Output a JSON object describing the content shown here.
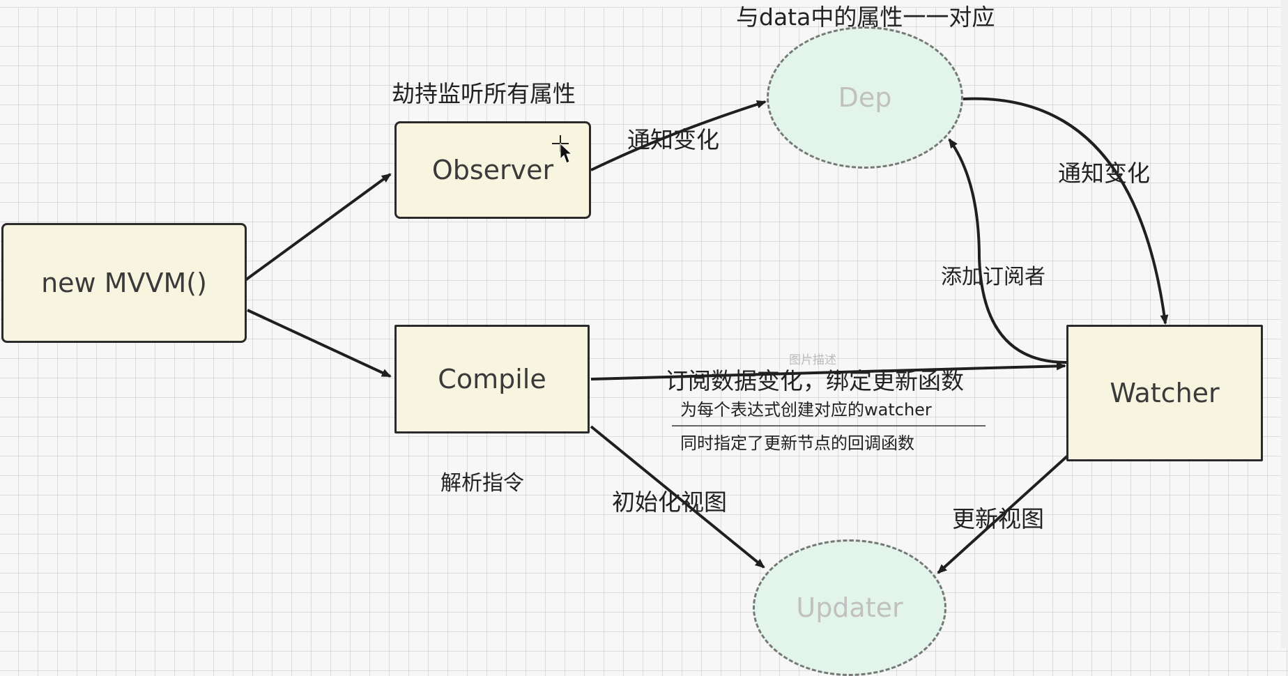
{
  "nodes": {
    "mvvm": "new MVVM()",
    "observer": "Observer",
    "compile": "Compile",
    "dep": "Dep",
    "watcher": "Watcher",
    "updater": "Updater"
  },
  "labels": {
    "hijack_all_props": "劫持监听所有属性",
    "dep_maps_data": "与data中的属性一一对应",
    "notify_change_observer": "通知变化",
    "notify_change_dep": "通知变化",
    "add_subscriber": "添加订阅者",
    "subscribe_bind": "订阅数据变化，绑定更新函数",
    "create_watcher": "为每个表达式创建对应的watcher",
    "set_update_callback": "同时指定了更新节点的回调函数",
    "parse_directives": "解析指令",
    "init_view": "初始化视图",
    "update_view": "更新视图",
    "image_caption": "图片描述"
  }
}
